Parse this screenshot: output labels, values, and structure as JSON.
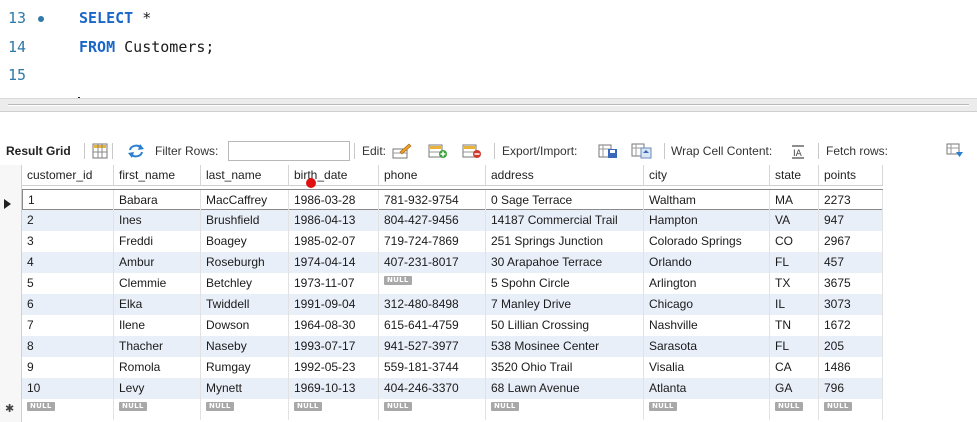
{
  "editor": {
    "lines": [
      {
        "number": "13",
        "keyword": "SELECT",
        "rest": " *"
      },
      {
        "number": "14",
        "keyword": "FROM",
        "rest": " Customers;"
      },
      {
        "number": "15",
        "keyword": "",
        "rest": ""
      }
    ]
  },
  "toolbar": {
    "result_grid_label": "Result Grid",
    "filter_rows_label": "Filter Rows:",
    "filter_rows_value": "",
    "edit_label": "Edit:",
    "export_import_label": "Export/Import:",
    "wrap_cell_label": "Wrap Cell Content:",
    "fetch_rows_label": "Fetch rows:"
  },
  "grid": {
    "columns": [
      "customer_id",
      "first_name",
      "last_name",
      "birth_date",
      "phone",
      "address",
      "city",
      "state",
      "points"
    ],
    "rows": [
      [
        "1",
        "Babara",
        "MacCaffrey",
        "1986-03-28",
        "781-932-9754",
        "0 Sage Terrace",
        "Waltham",
        "MA",
        "2273"
      ],
      [
        "2",
        "Ines",
        "Brushfield",
        "1986-04-13",
        "804-427-9456",
        "14187 Commercial Trail",
        "Hampton",
        "VA",
        "947"
      ],
      [
        "3",
        "Freddi",
        "Boagey",
        "1985-02-07",
        "719-724-7869",
        "251 Springs Junction",
        "Colorado Springs",
        "CO",
        "2967"
      ],
      [
        "4",
        "Ambur",
        "Roseburgh",
        "1974-04-14",
        "407-231-8017",
        "30 Arapahoe Terrace",
        "Orlando",
        "FL",
        "457"
      ],
      [
        "5",
        "Clemmie",
        "Betchley",
        "1973-11-07",
        "NULL",
        "5 Spohn Circle",
        "Arlington",
        "TX",
        "3675"
      ],
      [
        "6",
        "Elka",
        "Twiddell",
        "1991-09-04",
        "312-480-8498",
        "7 Manley Drive",
        "Chicago",
        "IL",
        "3073"
      ],
      [
        "7",
        "Ilene",
        "Dowson",
        "1964-08-30",
        "615-641-4759",
        "50 Lillian Crossing",
        "Nashville",
        "TN",
        "1672"
      ],
      [
        "8",
        "Thacher",
        "Naseby",
        "1993-07-17",
        "941-527-3977",
        "538 Mosinee Center",
        "Sarasota",
        "FL",
        "205"
      ],
      [
        "9",
        "Romola",
        "Rumgay",
        "1992-05-23",
        "559-181-3744",
        "3520 Ohio Trail",
        "Visalia",
        "CA",
        "1486"
      ],
      [
        "10",
        "Levy",
        "Mynett",
        "1969-10-13",
        "404-246-3370",
        "68 Lawn Avenue",
        "Atlanta",
        "GA",
        "796"
      ],
      [
        "NULL",
        "NULL",
        "NULL",
        "NULL",
        "NULL",
        "NULL",
        "NULL",
        "NULL",
        "NULL"
      ]
    ],
    "null_text": "NULL"
  },
  "colors": {
    "keyword": "#1a66c9",
    "line_number": "#2f7aa8",
    "alt_row": "#e9eff9",
    "null_badge": "#a8a8a8",
    "marker_dot": "#e01010"
  }
}
